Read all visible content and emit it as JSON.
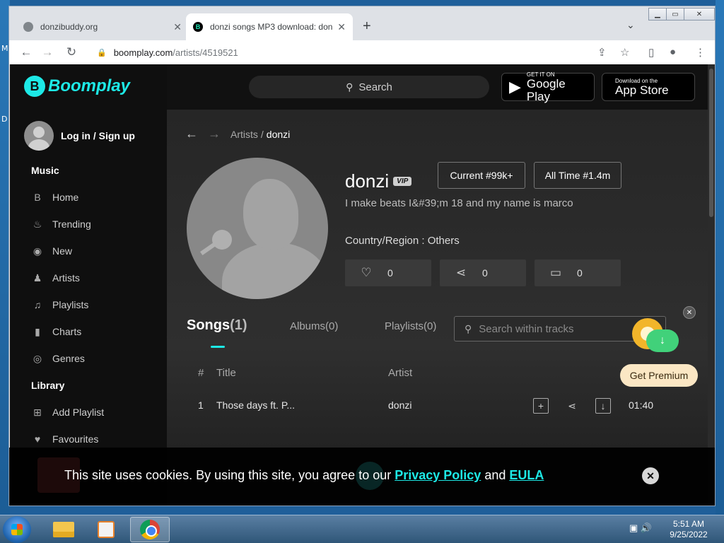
{
  "desktop": {
    "label_top": "M",
    "label_mid": "D"
  },
  "browser": {
    "tabs": [
      {
        "title": "donzibuddy.org",
        "active": false
      },
      {
        "title": "donzi songs MP3 download: don",
        "active": true
      }
    ],
    "url_host": "boomplay.com",
    "url_path": "/artists/4519521",
    "icons": [
      "back-icon",
      "forward-icon",
      "reload-icon",
      "lock-icon",
      "share-icon",
      "star-icon",
      "sidepanel-icon",
      "profile-icon",
      "menu-icon"
    ]
  },
  "sidebar": {
    "logo_text": "Boomplay",
    "login_label": "Log in /",
    "signup_label": "Sign up",
    "music_heading": "Music",
    "library_heading": "Library",
    "items": [
      {
        "label": "Home",
        "icon": "home-icon"
      },
      {
        "label": "Trending",
        "icon": "flame-icon"
      },
      {
        "label": "New",
        "icon": "disc-icon"
      },
      {
        "label": "Artists",
        "icon": "artist-icon"
      },
      {
        "label": "Playlists",
        "icon": "playlist-icon"
      },
      {
        "label": "Charts",
        "icon": "chart-icon"
      },
      {
        "label": "Genres",
        "icon": "genre-icon"
      }
    ],
    "library_items": [
      {
        "label": "Add Playlist",
        "icon": "add-playlist-icon"
      },
      {
        "label": "Favourites",
        "icon": "heart-icon"
      }
    ]
  },
  "header": {
    "search_placeholder": "Search",
    "google_play_small": "GET IT ON",
    "google_play_big": "Google Play",
    "app_store_small": "Download on the",
    "app_store_big": "App Store"
  },
  "breadcrumb": {
    "parent": "Artists",
    "separator": "/",
    "current": "donzi"
  },
  "artist": {
    "name": "donzi",
    "badge": "VIP",
    "current_rank": "Current  #99k+",
    "all_time_rank": "All Time  #1.4m",
    "bio": "I make beats I&#39;m 18 and my name is marco",
    "country": "Country/Region : Others",
    "likes": "0",
    "shares": "0",
    "comments": "0"
  },
  "tabs": {
    "songs_label": "Songs",
    "songs_count": "(1)",
    "albums": "Albums(0)",
    "playlists": "Playlists(0)",
    "track_search_placeholder": "Search within tracks"
  },
  "table": {
    "headers": {
      "num": "#",
      "title": "Title",
      "artist": "Artist"
    },
    "rows": [
      {
        "num": "1",
        "title": "Those days ft. P...",
        "artist": "donzi",
        "duration": "01:40"
      }
    ]
  },
  "promo": {
    "button": "Get Premium"
  },
  "cookie": {
    "text_before": "This site uses cookies. By using this site, you agree to our ",
    "privacy_link": "Privacy Policy",
    "text_and": " and ",
    "eula_link": "EULA"
  },
  "taskbar": {
    "time": "5:51 AM",
    "date": "9/25/2022"
  },
  "colors": {
    "accent": "#1de9e6",
    "background": "#111111",
    "premium": "#fbe7c4"
  }
}
